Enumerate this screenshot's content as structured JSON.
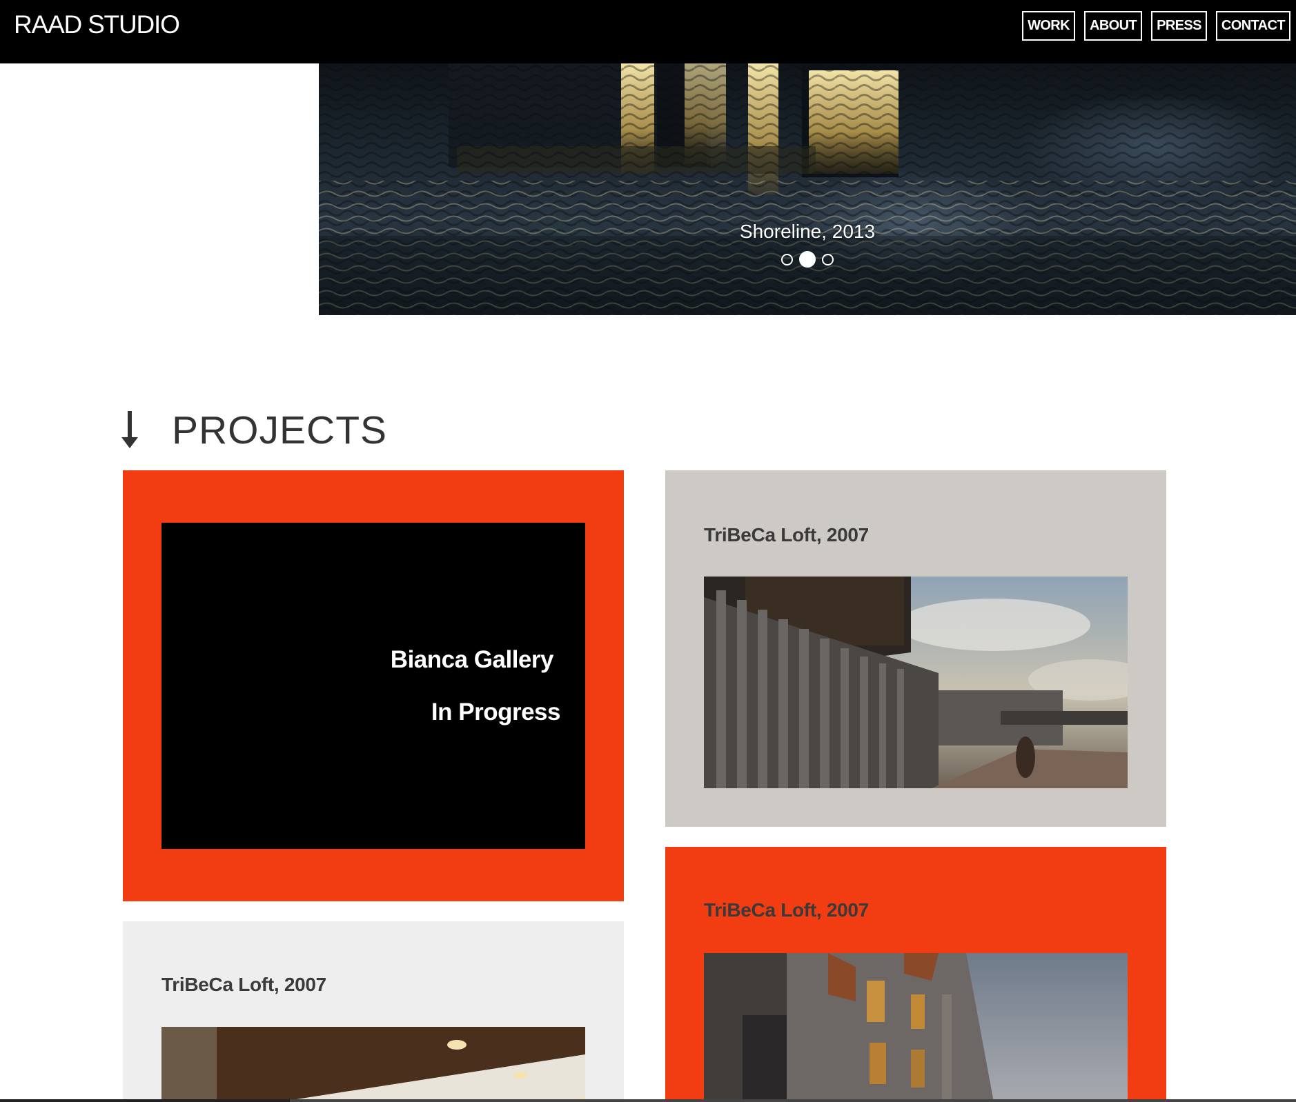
{
  "header": {
    "brand": "RAAD STUDIO",
    "nav": [
      "WORK",
      "ABOUT",
      "PRESS",
      "CONTACT"
    ]
  },
  "hero": {
    "caption": "Shoreline, 2013",
    "slide_count": 3,
    "active_slide": 2
  },
  "projects": {
    "heading": "PROJECTS",
    "heading_icon": "arrow-down-icon",
    "featured": {
      "name": "Bianca Gallery",
      "status": "In Progress"
    },
    "cards": [
      {
        "title": "TriBeCa Loft, 2007"
      },
      {
        "title": "TriBeCa Loft, 2007"
      },
      {
        "title": "TriBeCa Loft, 2007"
      }
    ]
  },
  "colors": {
    "accent_orange": "#f23c12",
    "card_grey": "#cdcac6",
    "card_light": "#eeeeee",
    "header_bg": "#000000"
  }
}
